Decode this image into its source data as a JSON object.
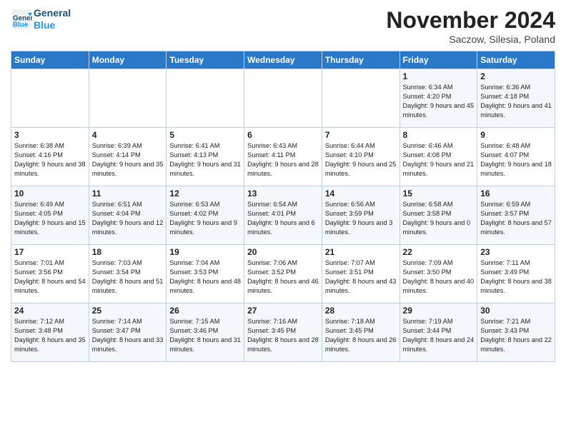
{
  "header": {
    "logo_line1": "General",
    "logo_line2": "Blue",
    "month": "November 2024",
    "location": "Saczow, Silesia, Poland"
  },
  "days_of_week": [
    "Sunday",
    "Monday",
    "Tuesday",
    "Wednesday",
    "Thursday",
    "Friday",
    "Saturday"
  ],
  "weeks": [
    [
      {
        "day": "",
        "info": ""
      },
      {
        "day": "",
        "info": ""
      },
      {
        "day": "",
        "info": ""
      },
      {
        "day": "",
        "info": ""
      },
      {
        "day": "",
        "info": ""
      },
      {
        "day": "1",
        "info": "Sunrise: 6:34 AM\nSunset: 4:20 PM\nDaylight: 9 hours and 45 minutes."
      },
      {
        "day": "2",
        "info": "Sunrise: 6:36 AM\nSunset: 4:18 PM\nDaylight: 9 hours and 41 minutes."
      }
    ],
    [
      {
        "day": "3",
        "info": "Sunrise: 6:38 AM\nSunset: 4:16 PM\nDaylight: 9 hours and 38 minutes."
      },
      {
        "day": "4",
        "info": "Sunrise: 6:39 AM\nSunset: 4:14 PM\nDaylight: 9 hours and 35 minutes."
      },
      {
        "day": "5",
        "info": "Sunrise: 6:41 AM\nSunset: 4:13 PM\nDaylight: 9 hours and 31 minutes."
      },
      {
        "day": "6",
        "info": "Sunrise: 6:43 AM\nSunset: 4:11 PM\nDaylight: 9 hours and 28 minutes."
      },
      {
        "day": "7",
        "info": "Sunrise: 6:44 AM\nSunset: 4:10 PM\nDaylight: 9 hours and 25 minutes."
      },
      {
        "day": "8",
        "info": "Sunrise: 6:46 AM\nSunset: 4:08 PM\nDaylight: 9 hours and 21 minutes."
      },
      {
        "day": "9",
        "info": "Sunrise: 6:48 AM\nSunset: 4:07 PM\nDaylight: 9 hours and 18 minutes."
      }
    ],
    [
      {
        "day": "10",
        "info": "Sunrise: 6:49 AM\nSunset: 4:05 PM\nDaylight: 9 hours and 15 minutes."
      },
      {
        "day": "11",
        "info": "Sunrise: 6:51 AM\nSunset: 4:04 PM\nDaylight: 9 hours and 12 minutes."
      },
      {
        "day": "12",
        "info": "Sunrise: 6:53 AM\nSunset: 4:02 PM\nDaylight: 9 hours and 9 minutes."
      },
      {
        "day": "13",
        "info": "Sunrise: 6:54 AM\nSunset: 4:01 PM\nDaylight: 9 hours and 6 minutes."
      },
      {
        "day": "14",
        "info": "Sunrise: 6:56 AM\nSunset: 3:59 PM\nDaylight: 9 hours and 3 minutes."
      },
      {
        "day": "15",
        "info": "Sunrise: 6:58 AM\nSunset: 3:58 PM\nDaylight: 9 hours and 0 minutes."
      },
      {
        "day": "16",
        "info": "Sunrise: 6:59 AM\nSunset: 3:57 PM\nDaylight: 8 hours and 57 minutes."
      }
    ],
    [
      {
        "day": "17",
        "info": "Sunrise: 7:01 AM\nSunset: 3:56 PM\nDaylight: 8 hours and 54 minutes."
      },
      {
        "day": "18",
        "info": "Sunrise: 7:03 AM\nSunset: 3:54 PM\nDaylight: 8 hours and 51 minutes."
      },
      {
        "day": "19",
        "info": "Sunrise: 7:04 AM\nSunset: 3:53 PM\nDaylight: 8 hours and 48 minutes."
      },
      {
        "day": "20",
        "info": "Sunrise: 7:06 AM\nSunset: 3:52 PM\nDaylight: 8 hours and 46 minutes."
      },
      {
        "day": "21",
        "info": "Sunrise: 7:07 AM\nSunset: 3:51 PM\nDaylight: 8 hours and 43 minutes."
      },
      {
        "day": "22",
        "info": "Sunrise: 7:09 AM\nSunset: 3:50 PM\nDaylight: 8 hours and 40 minutes."
      },
      {
        "day": "23",
        "info": "Sunrise: 7:11 AM\nSunset: 3:49 PM\nDaylight: 8 hours and 38 minutes."
      }
    ],
    [
      {
        "day": "24",
        "info": "Sunrise: 7:12 AM\nSunset: 3:48 PM\nDaylight: 8 hours and 35 minutes."
      },
      {
        "day": "25",
        "info": "Sunrise: 7:14 AM\nSunset: 3:47 PM\nDaylight: 8 hours and 33 minutes."
      },
      {
        "day": "26",
        "info": "Sunrise: 7:15 AM\nSunset: 3:46 PM\nDaylight: 8 hours and 31 minutes."
      },
      {
        "day": "27",
        "info": "Sunrise: 7:16 AM\nSunset: 3:45 PM\nDaylight: 8 hours and 28 minutes."
      },
      {
        "day": "28",
        "info": "Sunrise: 7:18 AM\nSunset: 3:45 PM\nDaylight: 8 hours and 26 minutes."
      },
      {
        "day": "29",
        "info": "Sunrise: 7:19 AM\nSunset: 3:44 PM\nDaylight: 8 hours and 24 minutes."
      },
      {
        "day": "30",
        "info": "Sunrise: 7:21 AM\nSunset: 3:43 PM\nDaylight: 8 hours and 22 minutes."
      }
    ]
  ]
}
